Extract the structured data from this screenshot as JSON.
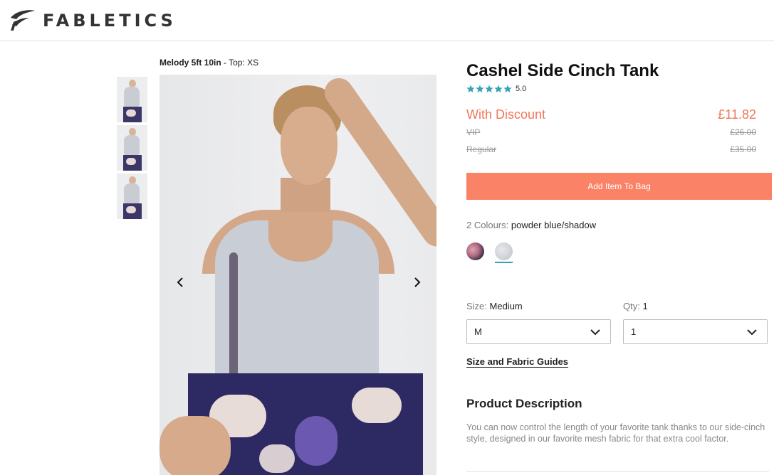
{
  "header": {
    "brand": "FABLETICS",
    "logo_icon": "fabletics-f-mark"
  },
  "gallery": {
    "model_name": "Melody 5ft 10in",
    "model_size": " - Top: XS",
    "thumbnails": [
      "thumbnail-1",
      "thumbnail-2",
      "thumbnail-3"
    ],
    "prev_icon": "chevron-left-icon",
    "next_icon": "chevron-right-icon"
  },
  "product": {
    "title": "Cashel Side Cinch Tank",
    "rating": "5.0",
    "rating_stars": 5,
    "star_color": "#3aa3b5",
    "prices": {
      "discount_label": "With Discount",
      "discount_value": "£11.82",
      "vip_label": "VIP",
      "vip_value": "£26.00",
      "regular_label": "Regular",
      "regular_value": "£35.00"
    },
    "add_to_bag": "Add Item To Bag",
    "accent_color": "#fa8266"
  },
  "colours": {
    "label": "2 Colours: ",
    "selected": "powder blue/shadow",
    "swatches": [
      "pink/shadow",
      "powder blue/shadow"
    ]
  },
  "size": {
    "label": "Size: ",
    "selected_name": "Medium",
    "value": "M"
  },
  "qty": {
    "label": "Qty: ",
    "selected": "1",
    "value": "1"
  },
  "guides_link": "Size and Fabric Guides",
  "description": {
    "heading": "Product Description",
    "text": "You can now control the length of your favorite tank thanks to our side-cinch style, designed in our favorite mesh fabric for that extra cool factor."
  }
}
